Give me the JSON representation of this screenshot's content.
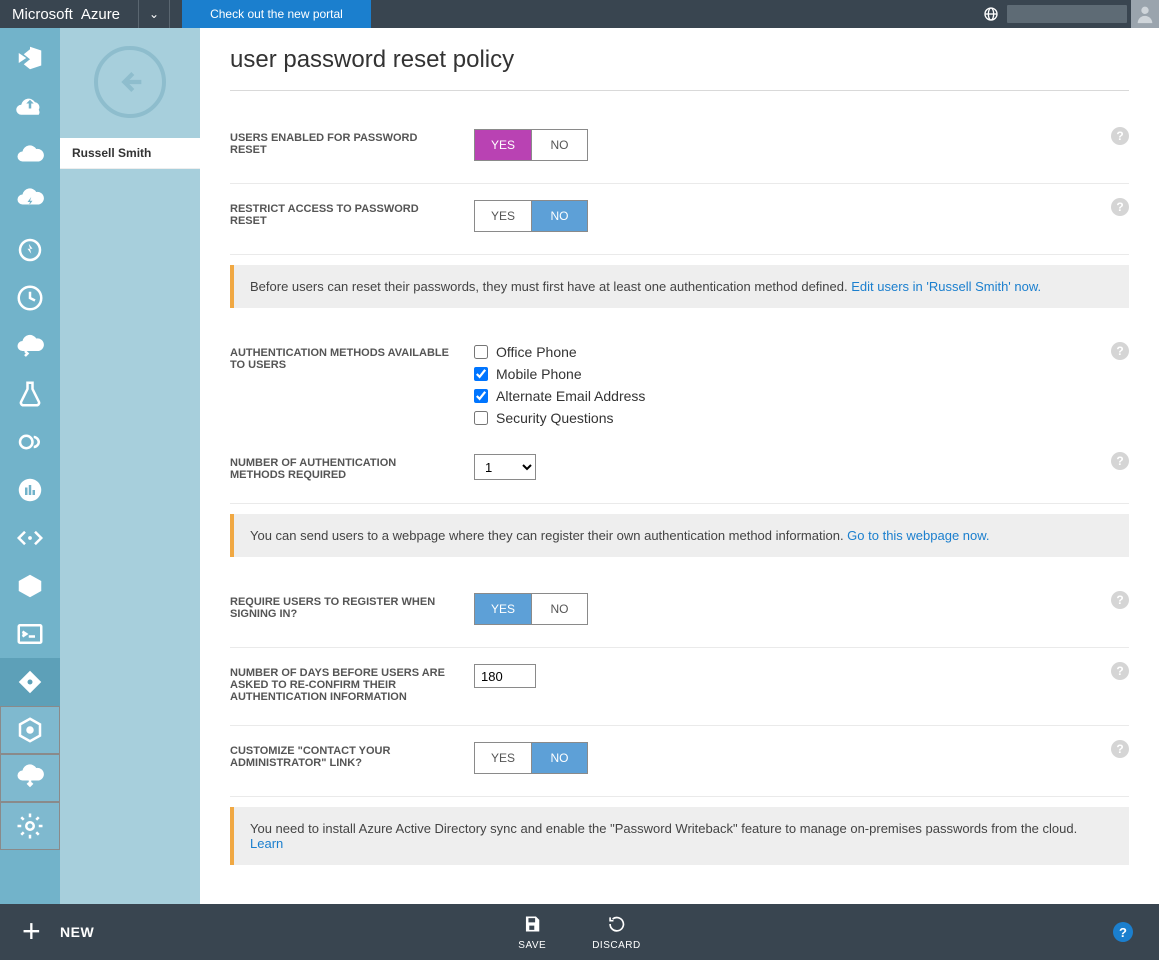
{
  "topbar": {
    "brand_company": "Microsoft",
    "brand_product": "Azure",
    "promo": "Check out the new portal"
  },
  "secondary": {
    "user_tab": "Russell Smith"
  },
  "page": {
    "title": "user password reset policy"
  },
  "fields": {
    "enabled_label": "USERS ENABLED FOR PASSWORD RESET",
    "enabled_yes": "YES",
    "enabled_no": "NO",
    "enabled_value": "YES",
    "restrict_label": "RESTRICT ACCESS TO PASSWORD RESET",
    "restrict_yes": "YES",
    "restrict_no": "NO",
    "restrict_value": "NO",
    "info_auth_prefix": "Before users can reset their passwords, they must first have at least one authentication method defined. ",
    "info_auth_link": "Edit users in 'Russell Smith' now.",
    "methods_label": "AUTHENTICATION METHODS AVAILABLE TO USERS",
    "method_office": "Office Phone",
    "method_mobile": "Mobile Phone",
    "method_email": "Alternate Email Address",
    "method_questions": "Security Questions",
    "method_office_checked": false,
    "method_mobile_checked": true,
    "method_email_checked": true,
    "method_questions_checked": false,
    "numreq_label": "NUMBER OF AUTHENTICATION METHODS REQUIRED",
    "numreq_value": "1",
    "info_reg_prefix": "You can send users to a webpage where they can register their own authentication method information. ",
    "info_reg_link": "Go to this webpage now.",
    "require_reg_label": "REQUIRE USERS TO REGISTER WHEN SIGNING IN?",
    "require_reg_yes": "YES",
    "require_reg_no": "NO",
    "require_reg_value": "YES",
    "days_label": "NUMBER OF DAYS BEFORE USERS ARE ASKED TO RE-CONFIRM THEIR AUTHENTICATION INFORMATION",
    "days_value": "180",
    "contact_label": "CUSTOMIZE \"CONTACT YOUR ADMINISTRATOR\" LINK?",
    "contact_yes": "YES",
    "contact_no": "NO",
    "contact_value": "NO",
    "info_writeback_prefix": "You need to install Azure Active Directory sync and enable the \"Password Writeback\" feature to manage on-premises passwords from the cloud. ",
    "info_writeback_link": "Learn"
  },
  "bottombar": {
    "new": "NEW",
    "save": "SAVE",
    "discard": "DISCARD"
  }
}
